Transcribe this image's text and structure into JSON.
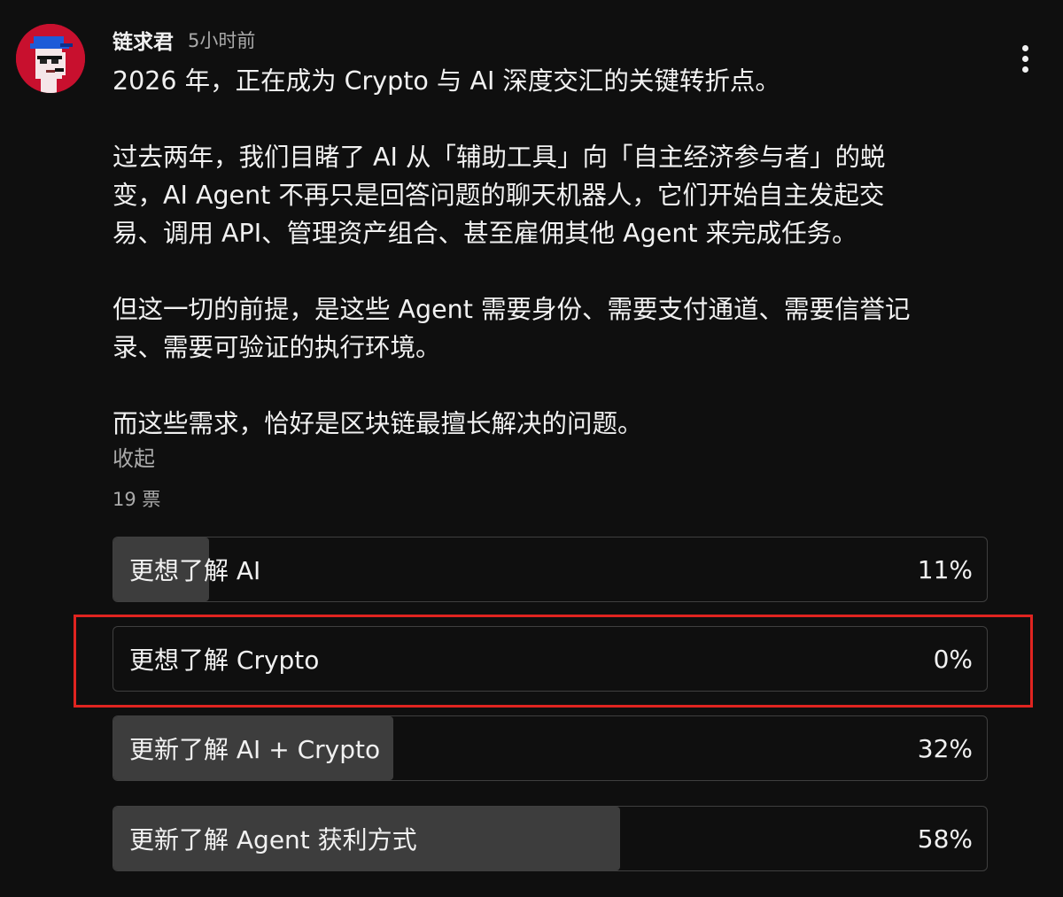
{
  "author": {
    "name": "链求君",
    "time": "5小时前"
  },
  "post": {
    "paragraphs": [
      [
        "2026 年，正在成为 Crypto 与 AI 深度交汇的关键转折点。"
      ],
      [
        "过去两年，我们目睹了 AI 从「辅助工具」向「自主经济参与者」的蜕",
        "变，AI Agent 不再只是回答问题的聊天机器人，它们开始自主发起交",
        "易、调用 API、管理资产组合、甚至雇佣其他 Agent 来完成任务。"
      ],
      [
        "但这一切的前提，是这些 Agent 需要身份、需要支付通道、需要信誉记",
        "录、需要可验证的执行环境。"
      ],
      [
        "而这些需求，恰好是区块链最擅长解决的问题。"
      ]
    ],
    "collapse_label": "收起"
  },
  "poll": {
    "votes_label": "19 票",
    "options": [
      {
        "label": "更想了解 AI",
        "percent_label": "11%",
        "percent": 11
      },
      {
        "label": "更想了解 Crypto",
        "percent_label": "0%",
        "percent": 0
      },
      {
        "label": "更新了解 AI + Crypto",
        "percent_label": "32%",
        "percent": 32
      },
      {
        "label": "更新了解 Agent 获利方式",
        "percent_label": "58%",
        "percent": 58
      }
    ],
    "highlighted_option": 1,
    "fill_color": "#3d3d3d",
    "highlight_color": "#e02420"
  }
}
